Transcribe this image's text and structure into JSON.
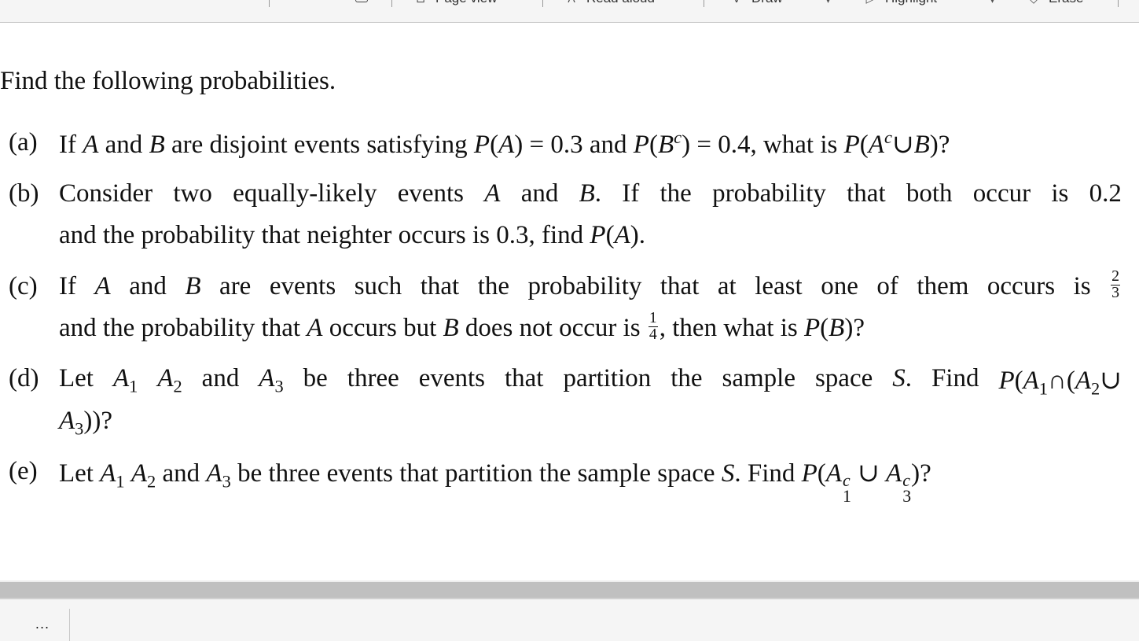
{
  "toolbar": {
    "items": [
      {
        "label": "Page view",
        "icon": "page-view-icon"
      },
      {
        "label": "Read aloud",
        "icon": "read-aloud-icon"
      },
      {
        "label": "Draw",
        "icon": "draw-pen-icon"
      },
      {
        "label": "Highlight",
        "icon": "highlighter-icon"
      },
      {
        "label": "Erase",
        "icon": "eraser-icon"
      }
    ],
    "icons_left": [
      "text-cursor-icon",
      "rotate-icon",
      "fit-page-icon"
    ]
  },
  "document": {
    "intro": "Find the following probabilities.",
    "questions": [
      {
        "label": "(a)",
        "lines": [
          "If A and B are disjoint events satisfying P(A) = 0.3 and P(B^c) = 0.4, what is P(A^c ∪ B)?"
        ]
      },
      {
        "label": "(b)",
        "lines": [
          "Consider two equally-likely events A and B. If the probability that both occur is 0.2",
          "and the probability that neighter occurs is 0.3, find P(A)."
        ]
      },
      {
        "label": "(c)",
        "lines": [
          "If A and B are events such that the probability that at least one of them occurs is 2/3",
          "and the probability that A occurs but B does not occur is 1/4, then what is P(B)?"
        ]
      },
      {
        "label": "(d)",
        "lines": [
          "Let A1 A2 and A3 be three events that partition the sample space S. Find P(A1 ∩ (A2 ∪",
          "A3))?"
        ]
      },
      {
        "label": "(e)",
        "lines": [
          "Let A1 A2 and A3 be three events that partition the sample space S. Find P(A1^c ∪ A3^c)?"
        ]
      }
    ],
    "q_text": {
      "a1": "If",
      "a2": "and",
      "a3": "are disjoint events satisfying",
      "a4": "= 0.3 and",
      "a5": "= 0.4, what is",
      "b1": "Consider",
      "b2": "two",
      "b3": "equally-likely",
      "b4": "events",
      "b5": "and",
      "b6": "If",
      "b7": "the",
      "b8": "probability",
      "b9": "that",
      "b10": "both",
      "b11": "occur",
      "b12": "is",
      "b13": "0.2",
      "b_line2a": "and the probability that neighter occurs is 0.3, find",
      "c1": "If",
      "c2": "and",
      "c3": "are",
      "c4": "events",
      "c5": "such",
      "c6": "that",
      "c7": "the",
      "c8": "probability",
      "c9": "that",
      "c10": "at",
      "c11": "least",
      "c12": "one",
      "c13": "of",
      "c14": "them",
      "c15": "occurs",
      "c16": "is",
      "c_line2a": "and the probability that",
      "c_line2b": "occurs but",
      "c_line2c": "does not occur is",
      "c_line2d": ", then what is",
      "frac_c1_num": "2",
      "frac_c1_den": "3",
      "frac_c2_num": "1",
      "frac_c2_den": "4",
      "d1": "Let",
      "d2": "and",
      "d3": "be",
      "d4": "three",
      "d5": "events",
      "d6": "that",
      "d7": "partition",
      "d8": "the",
      "d9": "sample",
      "d10": "space",
      "d11": "Find",
      "e_text1": "Let",
      "e_text2": "and",
      "e_text3": "be three events that partition the sample space",
      "e_text4": ". Find"
    }
  },
  "bottom": {
    "more_label": "..."
  }
}
